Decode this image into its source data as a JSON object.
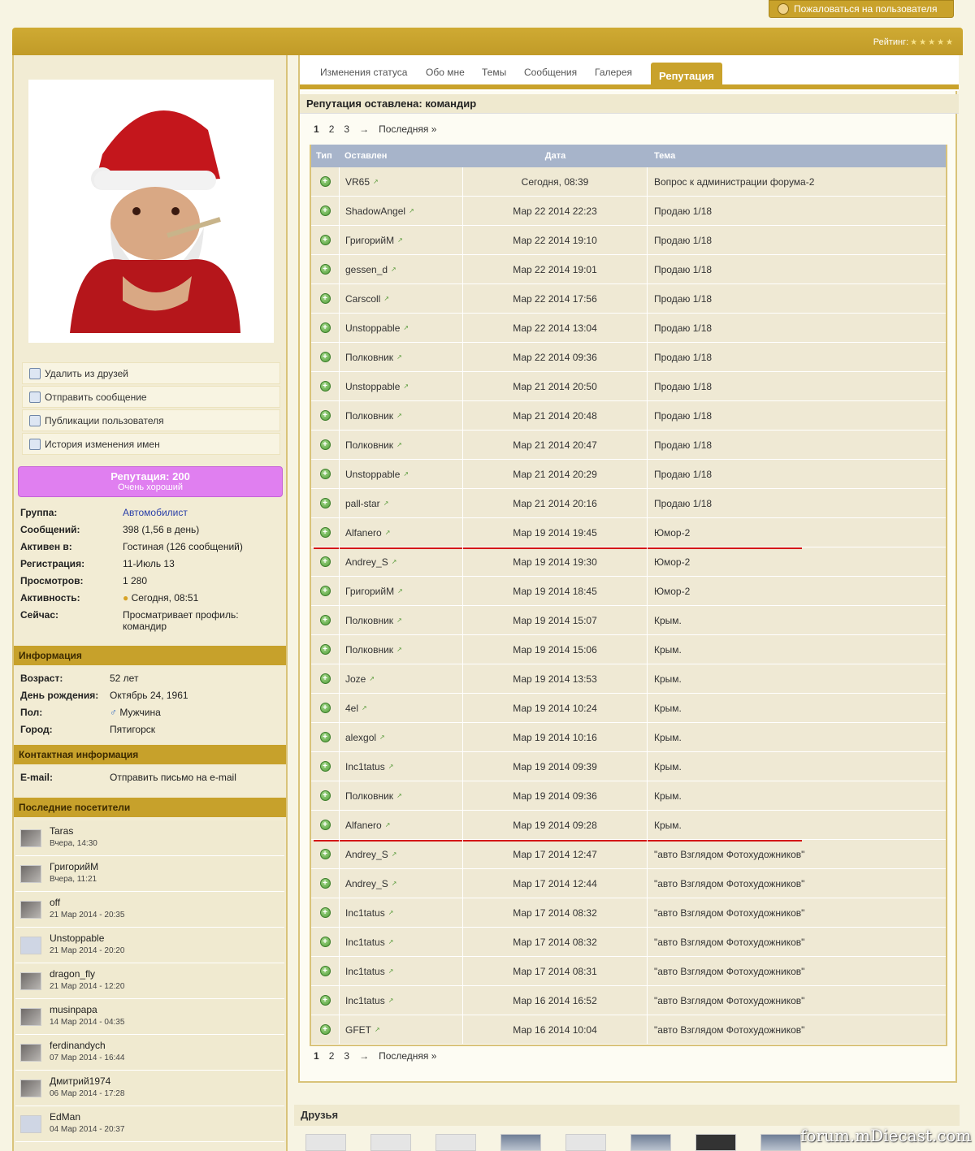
{
  "header": {
    "report_button": "Пожаловаться на пользователя",
    "rating_label": "Рейтинг:",
    "rating_stars": "★★★★★"
  },
  "sidebar": {
    "actions": [
      {
        "label": "Удалить из друзей",
        "icon": "remove-friend-icon"
      },
      {
        "label": "Отправить сообщение",
        "icon": "envelope-icon"
      },
      {
        "label": "Публикации пользователя",
        "icon": "document-icon"
      },
      {
        "label": "История изменения имен",
        "icon": "pencil-icon"
      }
    ],
    "reputation": {
      "title": "Репутация: 200",
      "subtitle": "Очень хороший"
    },
    "details": [
      {
        "k": "Группа:",
        "v": "Автомобилист"
      },
      {
        "k": "Сообщений:",
        "v": "398 (1,56 в день)"
      },
      {
        "k": "Активен в:",
        "v": "Гостиная (126 сообщений)"
      },
      {
        "k": "Регистрация:",
        "v": "11-Июль 13"
      },
      {
        "k": "Просмотров:",
        "v": "1 280"
      },
      {
        "k": "Активность:",
        "v": "Сегодня, 08:51"
      },
      {
        "k": "Сейчас:",
        "v": "Просматривает профиль: командир"
      }
    ],
    "info_head": "Информация",
    "info": [
      {
        "k": "Возраст:",
        "v": "52 лет"
      },
      {
        "k": "День рождения:",
        "v": "Октябрь 24, 1961"
      },
      {
        "k": "Пол:",
        "v": "Мужчина"
      },
      {
        "k": "Город:",
        "v": "Пятигорск"
      }
    ],
    "contact_head": "Контактная информация",
    "contact": {
      "k": "E-mail:",
      "v": "Отправить письмо на e-mail"
    },
    "visitors_head": "Последние посетители",
    "visitors": [
      {
        "name": "Taras",
        "date": "Вчера, 14:30"
      },
      {
        "name": "ГригорийМ",
        "date": "Вчера, 11:21"
      },
      {
        "name": "off",
        "date": "21 Мар 2014 - 20:35"
      },
      {
        "name": "Unstoppable",
        "date": "21 Мар 2014 - 20:20"
      },
      {
        "name": "dragon_fly",
        "date": "21 Мар 2014 - 12:20"
      },
      {
        "name": "musinpapa",
        "date": "14 Мар 2014 - 04:35"
      },
      {
        "name": "ferdinandych",
        "date": "07 Мар 2014 - 16:44"
      },
      {
        "name": "Дмитрий1974",
        "date": "06 Мар 2014 - 17:28"
      },
      {
        "name": "EdMan",
        "date": "04 Мар 2014 - 20:37"
      }
    ]
  },
  "main": {
    "tabs": [
      "Изменения статуса",
      "Обо мне",
      "Темы",
      "Сообщения",
      "Галерея",
      "Репутация"
    ],
    "active_tab": "Репутация",
    "section_title": "Репутация оставлена: командир",
    "pager": {
      "current": "1",
      "pages": [
        "2",
        "3"
      ],
      "arrow": "→",
      "last": "Последняя »"
    },
    "columns": [
      "Тип",
      "Оставлен",
      "Дата",
      "Тема"
    ],
    "rows": [
      {
        "who": "VR65",
        "date": "Сегодня, 08:39",
        "topic": "Вопрос к администрации форума-2"
      },
      {
        "who": "ShadowAngel",
        "date": "Мар 22 2014 22:23",
        "topic": "Продаю 1/18"
      },
      {
        "who": "ГригорийМ",
        "date": "Мар 22 2014 19:10",
        "topic": "Продаю 1/18"
      },
      {
        "who": "gessen_d",
        "date": "Мар 22 2014 19:01",
        "topic": "Продаю 1/18"
      },
      {
        "who": "Carscoll",
        "date": "Мар 22 2014 17:56",
        "topic": "Продаю 1/18"
      },
      {
        "who": "Unstoppable",
        "date": "Мар 22 2014 13:04",
        "topic": "Продаю 1/18"
      },
      {
        "who": "Полковник",
        "date": "Мар 22 2014 09:36",
        "topic": "Продаю 1/18"
      },
      {
        "who": "Unstoppable",
        "date": "Мар 21 2014 20:50",
        "topic": "Продаю 1/18"
      },
      {
        "who": "Полковник",
        "date": "Мар 21 2014 20:48",
        "topic": "Продаю 1/18"
      },
      {
        "who": "Полковник",
        "date": "Мар 21 2014 20:47",
        "topic": "Продаю 1/18"
      },
      {
        "who": "Unstoppable",
        "date": "Мар 21 2014 20:29",
        "topic": "Продаю 1/18"
      },
      {
        "who": "pall-star",
        "date": "Мар 21 2014 20:16",
        "topic": "Продаю 1/18"
      },
      {
        "who": "Alfanero",
        "date": "Мар 19 2014 19:45",
        "topic": "Юмор-2",
        "marked": true
      },
      {
        "who": "Andrey_S",
        "date": "Мар 19 2014 19:30",
        "topic": "Юмор-2"
      },
      {
        "who": "ГригорийМ",
        "date": "Мар 19 2014 18:45",
        "topic": "Юмор-2"
      },
      {
        "who": "Полковник",
        "date": "Мар 19 2014 15:07",
        "topic": "Крым."
      },
      {
        "who": "Полковник",
        "date": "Мар 19 2014 15:06",
        "topic": "Крым."
      },
      {
        "who": "Joze",
        "date": "Мар 19 2014 13:53",
        "topic": "Крым."
      },
      {
        "who": "4el",
        "date": "Мар 19 2014 10:24",
        "topic": "Крым."
      },
      {
        "who": "alexgol",
        "date": "Мар 19 2014 10:16",
        "topic": "Крым."
      },
      {
        "who": "Inc1tatus",
        "date": "Мар 19 2014 09:39",
        "topic": "Крым."
      },
      {
        "who": "Полковник",
        "date": "Мар 19 2014 09:36",
        "topic": "Крым."
      },
      {
        "who": "Alfanero",
        "date": "Мар 19 2014 09:28",
        "topic": "Крым.",
        "marked": true
      },
      {
        "who": "Andrey_S",
        "date": "Мар 17 2014 12:47",
        "topic": "\"авто Взглядом Фотохудожников\""
      },
      {
        "who": "Andrey_S",
        "date": "Мар 17 2014 12:44",
        "topic": "\"авто Взглядом Фотохудожников\""
      },
      {
        "who": "Inc1tatus",
        "date": "Мар 17 2014 08:32",
        "topic": "\"авто Взглядом Фотохудожников\""
      },
      {
        "who": "Inc1tatus",
        "date": "Мар 17 2014 08:32",
        "topic": "\"авто Взглядом Фотохудожников\""
      },
      {
        "who": "Inc1tatus",
        "date": "Мар 17 2014 08:31",
        "topic": "\"авто Взглядом Фотохудожников\""
      },
      {
        "who": "Inc1tatus",
        "date": "Мар 16 2014 16:52",
        "topic": "\"авто Взглядом Фотохудожников\""
      },
      {
        "who": "GFET",
        "date": "Мар 16 2014 10:04",
        "topic": "\"авто Взглядом Фотохудожников\""
      }
    ]
  },
  "friends": {
    "title": "Друзья"
  },
  "watermark": "forum.mDiecast.com",
  "colors": {
    "accent": "#c9a22b",
    "reputation": "#e07ff0",
    "table_header": "#a7b4ca",
    "marker_line": "#d41717"
  }
}
